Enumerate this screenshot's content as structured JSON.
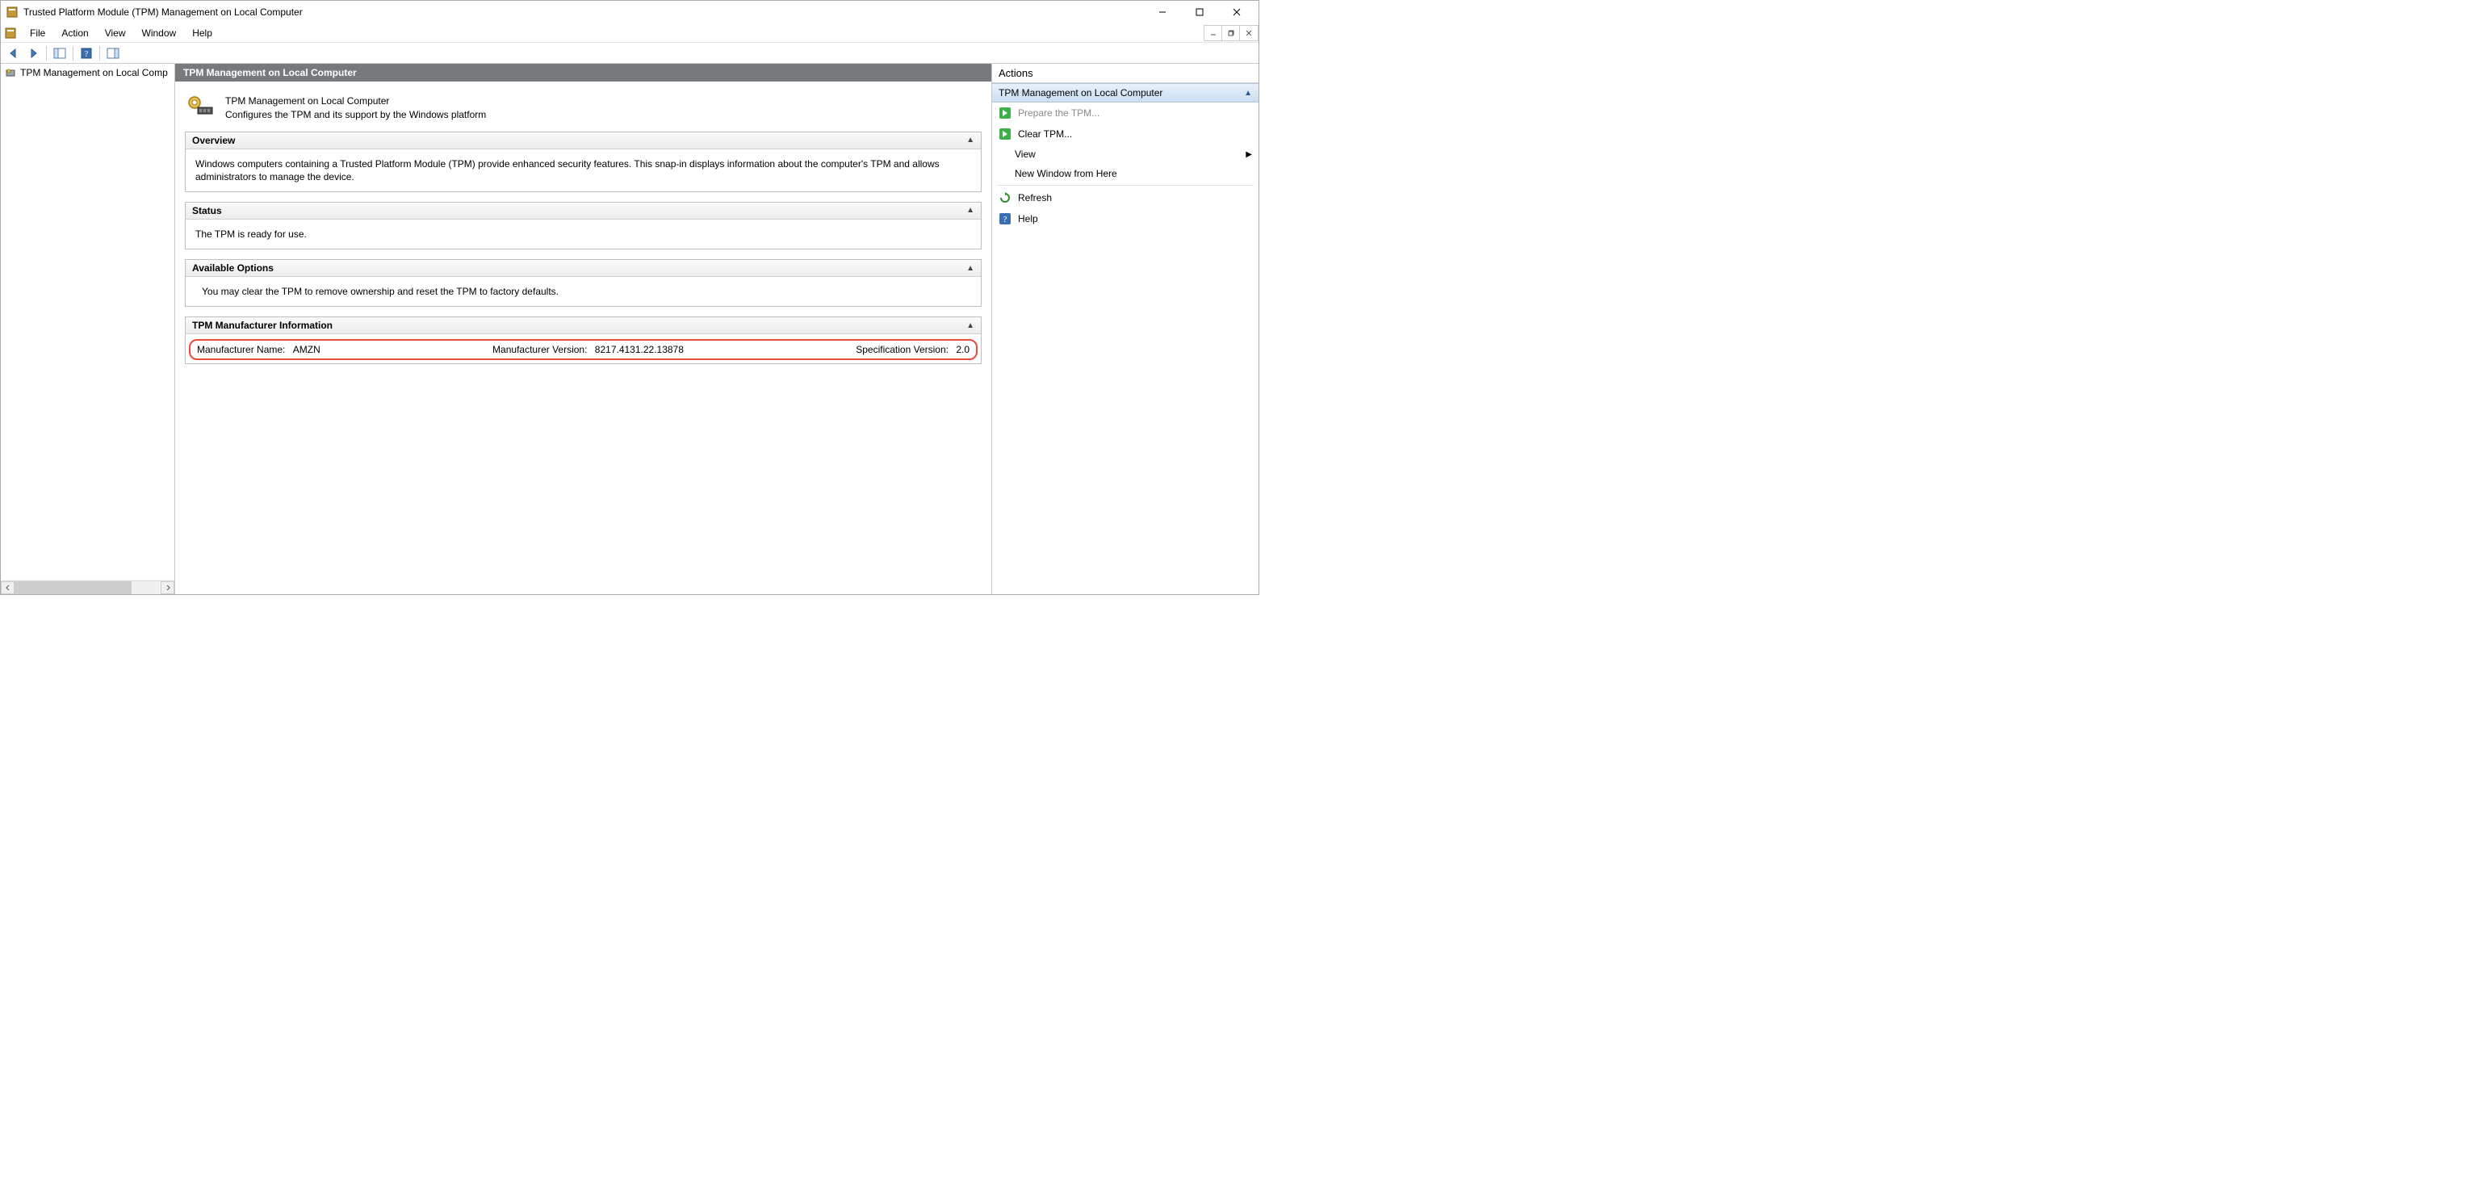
{
  "window": {
    "title": "Trusted Platform Module (TPM) Management on Local Computer"
  },
  "menu": {
    "file": "File",
    "action": "Action",
    "view": "View",
    "window": "Window",
    "help": "Help"
  },
  "tree": {
    "root": "TPM Management on Local Comp"
  },
  "center": {
    "header": "TPM Management on Local Computer",
    "intro_title": "TPM Management on Local Computer",
    "intro_sub": "Configures the TPM and its support by the Windows platform",
    "overview": {
      "title": "Overview",
      "body": "Windows computers containing a Trusted Platform Module (TPM) provide enhanced security features. This snap-in displays information about the computer's TPM and allows administrators to manage the device."
    },
    "status": {
      "title": "Status",
      "body": "The TPM is ready for use."
    },
    "options": {
      "title": "Available Options",
      "body": "You may clear the TPM to remove ownership and reset the TPM to factory defaults."
    },
    "mfr": {
      "title": "TPM Manufacturer Information",
      "name_label": "Manufacturer Name:",
      "name_value": "AMZN",
      "ver_label": "Manufacturer Version:",
      "ver_value": "8217.4131.22.13878",
      "spec_label": "Specification Version:",
      "spec_value": "2.0"
    }
  },
  "actions": {
    "title": "Actions",
    "group": "TPM Management on Local Computer",
    "prepare": "Prepare the TPM...",
    "clear": "Clear TPM...",
    "view": "View",
    "new_window": "New Window from Here",
    "refresh": "Refresh",
    "help": "Help"
  }
}
